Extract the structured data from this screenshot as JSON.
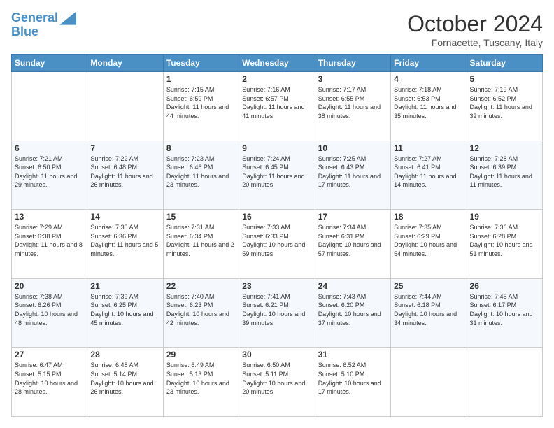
{
  "logo": {
    "line1": "General",
    "line2": "Blue"
  },
  "title": "October 2024",
  "location": "Fornacette, Tuscany, Italy",
  "days_of_week": [
    "Sunday",
    "Monday",
    "Tuesday",
    "Wednesday",
    "Thursday",
    "Friday",
    "Saturday"
  ],
  "weeks": [
    [
      {
        "day": "",
        "info": ""
      },
      {
        "day": "",
        "info": ""
      },
      {
        "day": "1",
        "info": "Sunrise: 7:15 AM\nSunset: 6:59 PM\nDaylight: 11 hours and 44 minutes."
      },
      {
        "day": "2",
        "info": "Sunrise: 7:16 AM\nSunset: 6:57 PM\nDaylight: 11 hours and 41 minutes."
      },
      {
        "day": "3",
        "info": "Sunrise: 7:17 AM\nSunset: 6:55 PM\nDaylight: 11 hours and 38 minutes."
      },
      {
        "day": "4",
        "info": "Sunrise: 7:18 AM\nSunset: 6:53 PM\nDaylight: 11 hours and 35 minutes."
      },
      {
        "day": "5",
        "info": "Sunrise: 7:19 AM\nSunset: 6:52 PM\nDaylight: 11 hours and 32 minutes."
      }
    ],
    [
      {
        "day": "6",
        "info": "Sunrise: 7:21 AM\nSunset: 6:50 PM\nDaylight: 11 hours and 29 minutes."
      },
      {
        "day": "7",
        "info": "Sunrise: 7:22 AM\nSunset: 6:48 PM\nDaylight: 11 hours and 26 minutes."
      },
      {
        "day": "8",
        "info": "Sunrise: 7:23 AM\nSunset: 6:46 PM\nDaylight: 11 hours and 23 minutes."
      },
      {
        "day": "9",
        "info": "Sunrise: 7:24 AM\nSunset: 6:45 PM\nDaylight: 11 hours and 20 minutes."
      },
      {
        "day": "10",
        "info": "Sunrise: 7:25 AM\nSunset: 6:43 PM\nDaylight: 11 hours and 17 minutes."
      },
      {
        "day": "11",
        "info": "Sunrise: 7:27 AM\nSunset: 6:41 PM\nDaylight: 11 hours and 14 minutes."
      },
      {
        "day": "12",
        "info": "Sunrise: 7:28 AM\nSunset: 6:39 PM\nDaylight: 11 hours and 11 minutes."
      }
    ],
    [
      {
        "day": "13",
        "info": "Sunrise: 7:29 AM\nSunset: 6:38 PM\nDaylight: 11 hours and 8 minutes."
      },
      {
        "day": "14",
        "info": "Sunrise: 7:30 AM\nSunset: 6:36 PM\nDaylight: 11 hours and 5 minutes."
      },
      {
        "day": "15",
        "info": "Sunrise: 7:31 AM\nSunset: 6:34 PM\nDaylight: 11 hours and 2 minutes."
      },
      {
        "day": "16",
        "info": "Sunrise: 7:33 AM\nSunset: 6:33 PM\nDaylight: 10 hours and 59 minutes."
      },
      {
        "day": "17",
        "info": "Sunrise: 7:34 AM\nSunset: 6:31 PM\nDaylight: 10 hours and 57 minutes."
      },
      {
        "day": "18",
        "info": "Sunrise: 7:35 AM\nSunset: 6:29 PM\nDaylight: 10 hours and 54 minutes."
      },
      {
        "day": "19",
        "info": "Sunrise: 7:36 AM\nSunset: 6:28 PM\nDaylight: 10 hours and 51 minutes."
      }
    ],
    [
      {
        "day": "20",
        "info": "Sunrise: 7:38 AM\nSunset: 6:26 PM\nDaylight: 10 hours and 48 minutes."
      },
      {
        "day": "21",
        "info": "Sunrise: 7:39 AM\nSunset: 6:25 PM\nDaylight: 10 hours and 45 minutes."
      },
      {
        "day": "22",
        "info": "Sunrise: 7:40 AM\nSunset: 6:23 PM\nDaylight: 10 hours and 42 minutes."
      },
      {
        "day": "23",
        "info": "Sunrise: 7:41 AM\nSunset: 6:21 PM\nDaylight: 10 hours and 39 minutes."
      },
      {
        "day": "24",
        "info": "Sunrise: 7:43 AM\nSunset: 6:20 PM\nDaylight: 10 hours and 37 minutes."
      },
      {
        "day": "25",
        "info": "Sunrise: 7:44 AM\nSunset: 6:18 PM\nDaylight: 10 hours and 34 minutes."
      },
      {
        "day": "26",
        "info": "Sunrise: 7:45 AM\nSunset: 6:17 PM\nDaylight: 10 hours and 31 minutes."
      }
    ],
    [
      {
        "day": "27",
        "info": "Sunrise: 6:47 AM\nSunset: 5:15 PM\nDaylight: 10 hours and 28 minutes."
      },
      {
        "day": "28",
        "info": "Sunrise: 6:48 AM\nSunset: 5:14 PM\nDaylight: 10 hours and 26 minutes."
      },
      {
        "day": "29",
        "info": "Sunrise: 6:49 AM\nSunset: 5:13 PM\nDaylight: 10 hours and 23 minutes."
      },
      {
        "day": "30",
        "info": "Sunrise: 6:50 AM\nSunset: 5:11 PM\nDaylight: 10 hours and 20 minutes."
      },
      {
        "day": "31",
        "info": "Sunrise: 6:52 AM\nSunset: 5:10 PM\nDaylight: 10 hours and 17 minutes."
      },
      {
        "day": "",
        "info": ""
      },
      {
        "day": "",
        "info": ""
      }
    ]
  ]
}
